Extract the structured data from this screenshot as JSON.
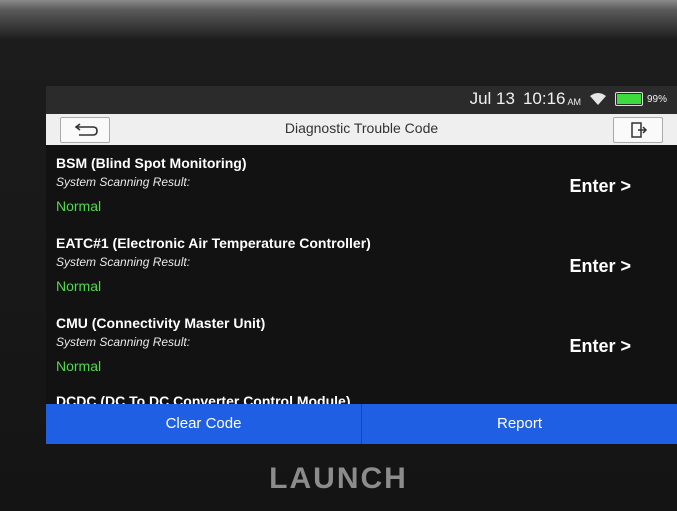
{
  "status": {
    "date": "Jul 13",
    "time": "10:16",
    "ampm": "AM",
    "battery_percent": "99%",
    "battery_level": 0.99
  },
  "header": {
    "title": "Diagnostic Trouble Code",
    "back_icon": "back-arrow-icon",
    "exit_icon": "exit-icon"
  },
  "items": [
    {
      "title": "BSM (Blind Spot Monitoring)",
      "subtitle": "System Scanning Result:",
      "status": "Normal",
      "action": "Enter >"
    },
    {
      "title": "EATC#1 (Electronic Air Temperature Controller)",
      "subtitle": "System Scanning Result:",
      "status": "Normal",
      "action": "Enter >"
    },
    {
      "title": "CMU (Connectivity Master Unit)",
      "subtitle": "System Scanning Result:",
      "status": "Normal",
      "action": "Enter >"
    },
    {
      "title": "DCDC (DC To DC Converter Control Module)"
    }
  ],
  "footer": {
    "clear_label": "Clear Code",
    "report_label": "Report"
  },
  "brand": "LAUNCH",
  "colors": {
    "accent": "#1f5fe3",
    "status_ok": "#4fd94f"
  }
}
